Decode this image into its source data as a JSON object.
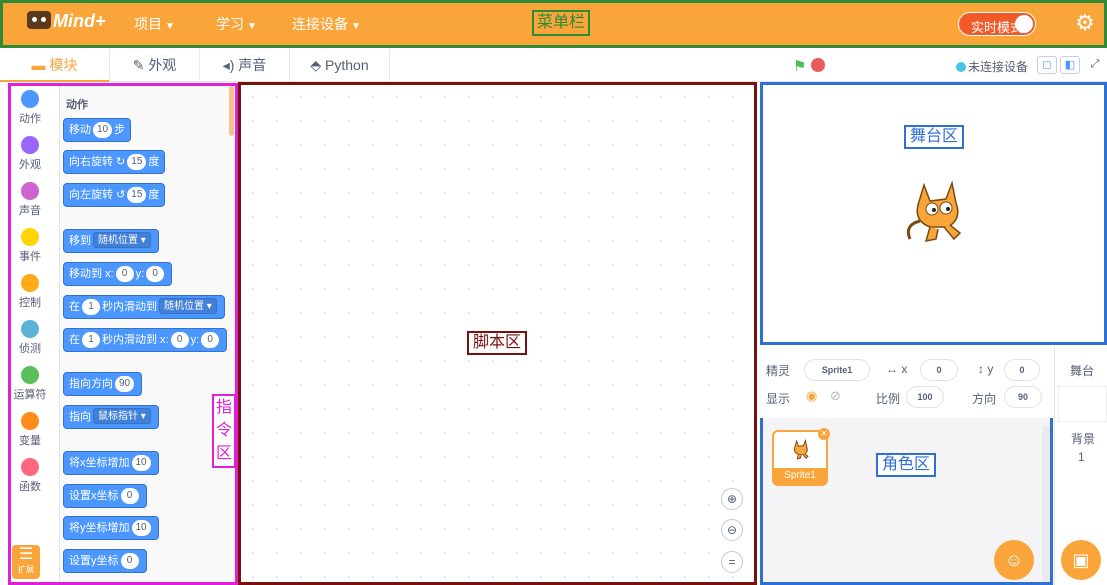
{
  "menubar": {
    "logo": "Mind+",
    "items": [
      "项目",
      "学习",
      "连接设备"
    ],
    "label": "菜单栏",
    "realtime_mode": "实时模式"
  },
  "tabs": [
    "模块",
    "外观",
    "声音",
    "Python"
  ],
  "connection": "未连接设备",
  "categories": [
    {
      "label": "动作",
      "color": "#4c97ff"
    },
    {
      "label": "外观",
      "color": "#9966ff"
    },
    {
      "label": "声音",
      "color": "#cf63cf"
    },
    {
      "label": "事件",
      "color": "#ffd500"
    },
    {
      "label": "控制",
      "color": "#ffab19"
    },
    {
      "label": "侦测",
      "color": "#5cb1d6"
    },
    {
      "label": "运算符",
      "color": "#59c059"
    },
    {
      "label": "变量",
      "color": "#ff8c1a"
    },
    {
      "label": "函数",
      "color": "#ff6680"
    }
  ],
  "extension_label": "扩展",
  "palette": {
    "title": "动作",
    "blocks": {
      "move": {
        "pre": "移动",
        "v": "10",
        "post": "步"
      },
      "turn_right": {
        "pre": "向右旋转 ↻",
        "v": "15",
        "post": "度"
      },
      "turn_left": {
        "pre": "向左旋转 ↺",
        "v": "15",
        "post": "度"
      },
      "goto": {
        "pre": "移到",
        "d": "随机位置 ▾"
      },
      "goto_xy": {
        "pre": "移动到 x:",
        "x": "0",
        "mid": "y:",
        "y": "0"
      },
      "glide": {
        "pre": "在",
        "v": "1",
        "mid": "秒内滑动到",
        "d": "随机位置 ▾"
      },
      "glide_xy": {
        "pre": "在",
        "v": "1",
        "mid": "秒内滑动到 x:",
        "x": "0",
        "mid2": "y:",
        "y": "0"
      },
      "point_dir": {
        "pre": "指向方向",
        "v": "90"
      },
      "point_to": {
        "pre": "指向",
        "d": "鼠标指针 ▾"
      },
      "change_x": {
        "pre": "将x坐标增加",
        "v": "10"
      },
      "set_x": {
        "pre": "设置x坐标",
        "v": "0"
      },
      "change_y": {
        "pre": "将y坐标增加",
        "v": "10"
      },
      "set_y": {
        "pre": "设置y坐标",
        "v": "0"
      }
    }
  },
  "cmd_label": "指令区",
  "script_label": "脚本区",
  "stage_label": "舞台区",
  "sprite_info": {
    "sprite_label": "精灵",
    "sprite_name": "Sprite1",
    "x_label": "x",
    "x": "0",
    "y_label": "y",
    "y": "0",
    "show_label": "显示",
    "size_label": "比例",
    "size": "100",
    "dir_label": "方向",
    "dir": "90"
  },
  "sprites": [
    {
      "name": "Sprite1"
    }
  ],
  "role_label": "角色区",
  "stage_col": {
    "title": "舞台",
    "backdrop_label": "背景",
    "backdrop_count": "1"
  }
}
